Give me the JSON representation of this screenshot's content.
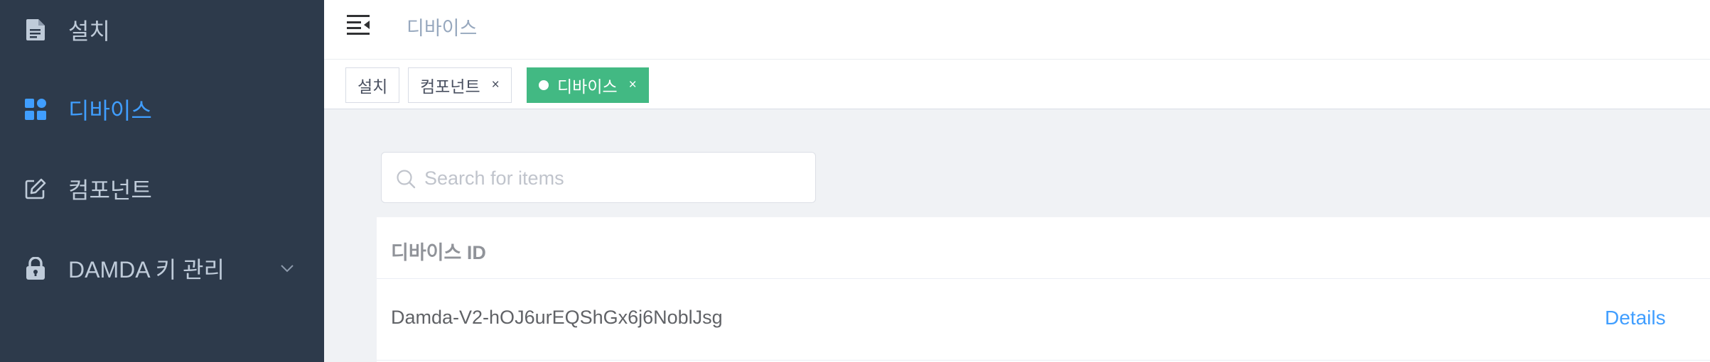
{
  "sidebar": {
    "items": [
      {
        "label": "설치",
        "icon": "document-icon"
      },
      {
        "label": "디바이스",
        "icon": "dashboard-icon",
        "active": true
      },
      {
        "label": "컴포넌트",
        "icon": "edit-icon"
      },
      {
        "label": "DAMDA 키 관리",
        "icon": "lock-icon",
        "expandable": true
      }
    ]
  },
  "navbar": {
    "breadcrumb": "디바이스"
  },
  "tags": [
    {
      "label": "설치"
    },
    {
      "label": "컴포넌트",
      "close": "×"
    },
    {
      "label": "디바이스",
      "close": "×",
      "active": true
    }
  ],
  "search": {
    "placeholder": "Search for items",
    "value": ""
  },
  "table": {
    "header": "디바이스 ID",
    "rows": [
      {
        "id": "Damda-V2-hOJ6urEQShGx6j6NoblJsg",
        "action": "Details"
      }
    ]
  },
  "colors": {
    "sidebar_bg": "#2d3a4b",
    "accent": "#409eff",
    "active_tag": "#42b983"
  }
}
